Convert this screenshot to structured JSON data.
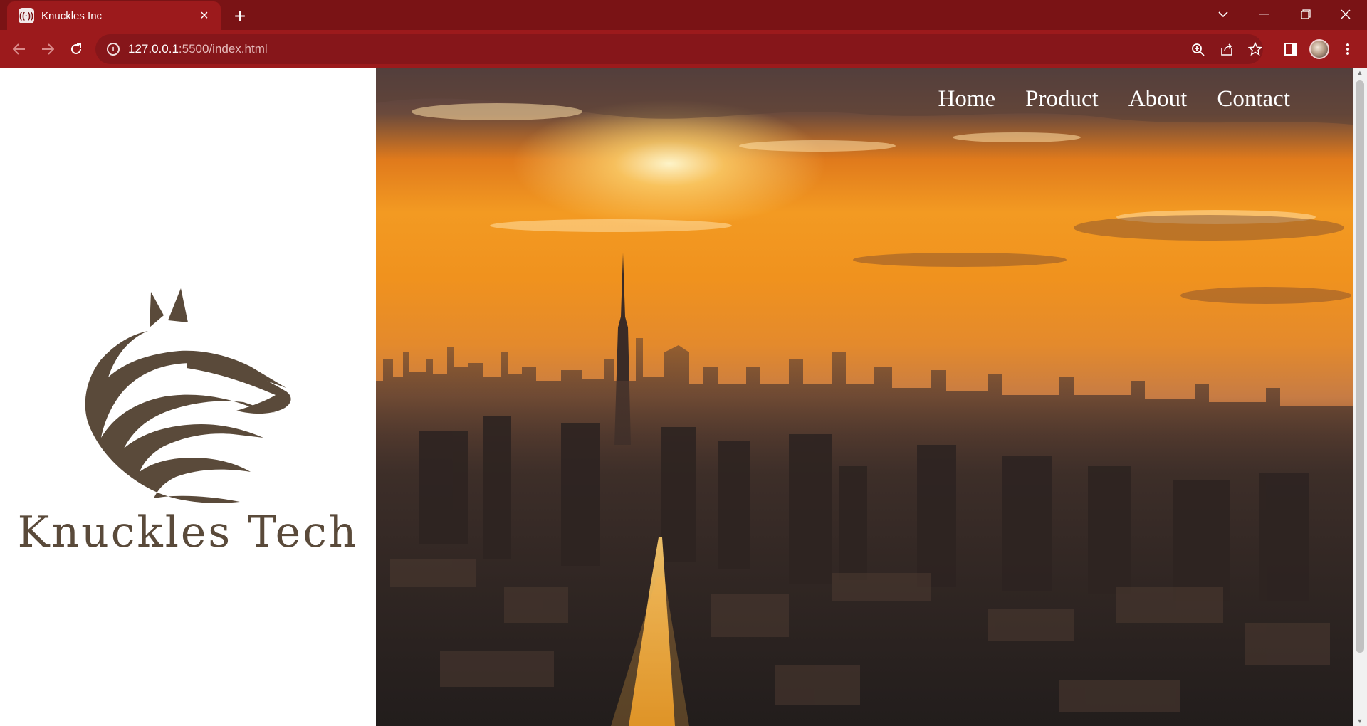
{
  "browser": {
    "tab_title": "Knuckles Inc",
    "url_host": "127.0.0.1",
    "url_rest": ":5500/index.html",
    "accent": "#9c1a1c",
    "tabstrip_color": "#7a1315"
  },
  "page": {
    "brand_name": "Knuckles Tech",
    "brand_color": "#5a4a3a",
    "nav": [
      "Home",
      "Product",
      "About",
      "Contact"
    ]
  },
  "icons": {
    "back": "arrow-left-icon",
    "forward": "arrow-right-icon",
    "reload": "reload-icon",
    "site_info": "info-icon",
    "zoom": "zoom-icon",
    "share": "share-icon",
    "bookmark": "star-icon",
    "side_panel": "side-panel-icon",
    "menu": "kebab-menu-icon"
  }
}
